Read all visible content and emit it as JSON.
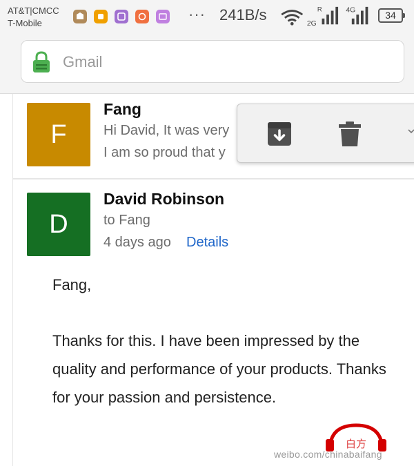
{
  "status_bar": {
    "carrier_1": "AT&T|CMCC",
    "carrier_2": "T-Mobile",
    "dots": "···",
    "net_speed": "241B/s",
    "network_r": "R",
    "network_2g": "2G",
    "network_4g": "4G",
    "battery": "34"
  },
  "search": {
    "placeholder": "Gmail",
    "lock_color": "#4caf50"
  },
  "messages": [
    {
      "avatar_letter": "F",
      "avatar_color": "#c88a00",
      "sender": "Fang",
      "snippet_1": "Hi David, It was very",
      "snippet_2": "I am so proud that y"
    },
    {
      "avatar_letter": "D",
      "avatar_color": "#156f23",
      "sender": "David Robinson",
      "to": "to Fang",
      "time": "4 days ago",
      "details": "Details",
      "greeting": "Fang,",
      "body": "Thanks for this. I have been impressed by the quality and performance of your products. Thanks for your passion and persistence."
    }
  ],
  "actions": {
    "archive_icon": "archive-icon",
    "delete_icon": "trash-icon",
    "more_icon": "chevron-down-icon"
  },
  "watermark": {
    "text": "weibo.com/chinabaifang",
    "logo_text": "白方"
  },
  "colors": {
    "link": "#1f66c9",
    "status_bg": "#f4f4f4"
  }
}
